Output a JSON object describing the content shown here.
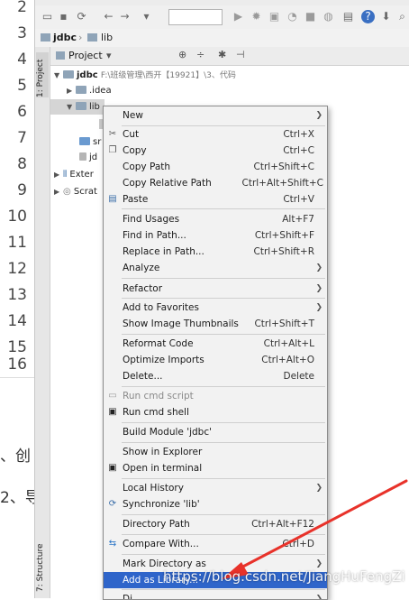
{
  "line_numbers": [
    "2",
    "3",
    "4",
    "5",
    "6",
    "7",
    "8",
    "9",
    "10",
    "11",
    "12",
    "13",
    "14",
    "15",
    "16"
  ],
  "background_fragments": [
    "、创",
    "2、导"
  ],
  "breadcrumb": {
    "project": "jdbc",
    "folder": "lib"
  },
  "project_panel": {
    "title": "Project",
    "tab_project": "1: Project",
    "tab_structure": "7: Structure",
    "tree": {
      "root_name": "jdbc",
      "root_path": "F:\\班级管理\\西开【19921】\\3、代码",
      "idea": ".idea",
      "lib": "lib",
      "src_partial": "sr",
      "jd_partial": "jd",
      "external_partial": "Exter",
      "scratch_partial": "Scrat"
    }
  },
  "context_menu": {
    "new": "New",
    "cut": "Cut",
    "cut_sc": "Ctrl+X",
    "copy": "Copy",
    "copy_sc": "Ctrl+C",
    "copy_path": "Copy Path",
    "copy_path_sc": "Ctrl+Shift+C",
    "copy_rel": "Copy Relative Path",
    "copy_rel_sc": "Ctrl+Alt+Shift+C",
    "paste": "Paste",
    "paste_sc": "Ctrl+V",
    "find_usages": "Find Usages",
    "find_usages_sc": "Alt+F7",
    "find_path": "Find in Path...",
    "find_path_sc": "Ctrl+Shift+F",
    "replace_path": "Replace in Path...",
    "replace_path_sc": "Ctrl+Shift+R",
    "analyze": "Analyze",
    "refactor": "Refactor",
    "favorites": "Add to Favorites",
    "thumbnails": "Show Image Thumbnails",
    "thumbnails_sc": "Ctrl+Shift+T",
    "reformat": "Reformat Code",
    "reformat_sc": "Ctrl+Alt+L",
    "optimize": "Optimize Imports",
    "optimize_sc": "Ctrl+Alt+O",
    "delete": "Delete...",
    "delete_sc": "Delete",
    "run_script": "Run cmd script",
    "run_shell": "Run cmd shell",
    "build_module": "Build Module 'jdbc'",
    "explorer": "Show in Explorer",
    "terminal": "Open in terminal",
    "local_history": "Local History",
    "sync": "Synchronize 'lib'",
    "dir_path": "Directory Path",
    "dir_path_sc": "Ctrl+Alt+F12",
    "compare": "Compare With...",
    "compare_sc": "Ctrl+D",
    "mark_dir": "Mark Directory as",
    "add_library": "Add as Library...",
    "last_partial": "Di"
  },
  "watermark": "https://blog.csdn.net/JiangHuFengZi",
  "colors": {
    "highlight": "#2f65ca",
    "arrow": "#e8322a",
    "folder": "#8fa4b8"
  }
}
